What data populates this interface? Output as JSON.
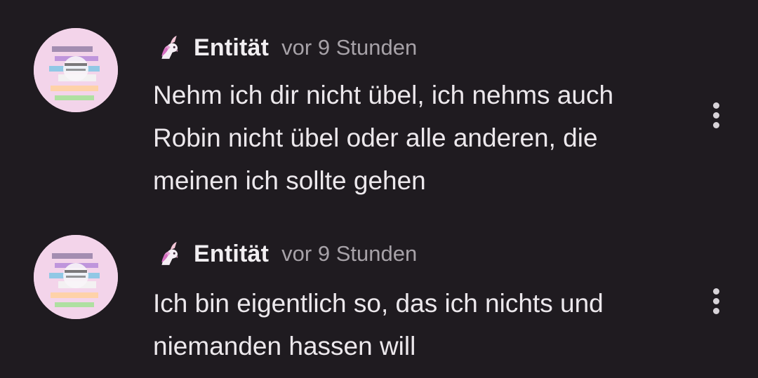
{
  "colors": {
    "background": "#1f1b20",
    "author": "#f1eef1",
    "timestamp": "#a7a2a8",
    "body_text": "#ece8ec",
    "menu_dots": "#d7d3d8"
  },
  "comments": [
    {
      "avatar_icon": "avatar-image",
      "badge_icon": "unicorn-icon",
      "author": "Entität",
      "timestamp": "vor 9 Stunden",
      "text": "Nehm ich dir nicht übel, ich nehms auch Robin nicht übel oder alle anderen, die meinen ich sollte gehen",
      "menu_icon": "more-vertical-icon"
    },
    {
      "avatar_icon": "avatar-image",
      "badge_icon": "unicorn-icon",
      "author": "Entität",
      "timestamp": "vor 9 Stunden",
      "text": "Ich bin eigentlich so, das ich nichts und niemanden hassen will",
      "menu_icon": "more-vertical-icon"
    }
  ]
}
